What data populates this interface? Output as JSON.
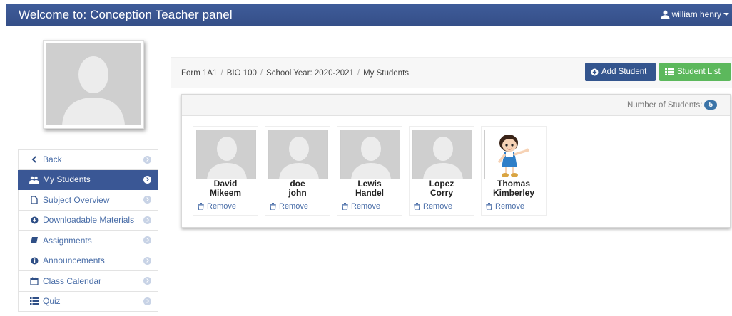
{
  "header": {
    "title": "Welcome to: Conception Teacher panel",
    "user_name": "william henry",
    "user_icon": "user-icon",
    "caret_icon": "caret-down-icon"
  },
  "sidebar": {
    "items": [
      {
        "label": "Back",
        "icon": "chevron-left-icon",
        "active": false
      },
      {
        "label": "My Students",
        "icon": "users-icon",
        "active": true
      },
      {
        "label": "Subject Overview",
        "icon": "file-icon",
        "active": false
      },
      {
        "label": "Downloadable Materials",
        "icon": "download-circle-icon",
        "active": false
      },
      {
        "label": "Assignments",
        "icon": "book-icon",
        "active": false
      },
      {
        "label": "Announcements",
        "icon": "info-icon",
        "active": false
      },
      {
        "label": "Class Calendar",
        "icon": "calendar-icon",
        "active": false
      },
      {
        "label": "Quiz",
        "icon": "list-icon",
        "active": false
      }
    ]
  },
  "breadcrumb": {
    "items": [
      "Form 1A1",
      "BIO 100",
      "School Year: 2020-2021",
      "My Students"
    ]
  },
  "toolbar": {
    "add_student_label": "Add Student",
    "student_list_label": "Student List"
  },
  "students_panel": {
    "count_label": "Number of Students:",
    "count": "5",
    "remove_label": "Remove",
    "students": [
      {
        "first": "David",
        "last": "Mikeem",
        "avatar": "default-avatar-icon"
      },
      {
        "first": "doe",
        "last": "john",
        "avatar": "default-avatar-icon"
      },
      {
        "first": "Lewis",
        "last": "Handel",
        "avatar": "default-avatar-icon"
      },
      {
        "first": "Lopez",
        "last": "Corry",
        "avatar": "default-avatar-icon"
      },
      {
        "first": "Thomas",
        "last": "Kimberley",
        "avatar": "cartoon-girl-avatar"
      }
    ]
  },
  "colors": {
    "header_bg": "#3b5998",
    "active_nav": "#3a5795",
    "add_button": "#34558e",
    "list_button": "#5cb85c",
    "link": "#4a6ea8"
  }
}
